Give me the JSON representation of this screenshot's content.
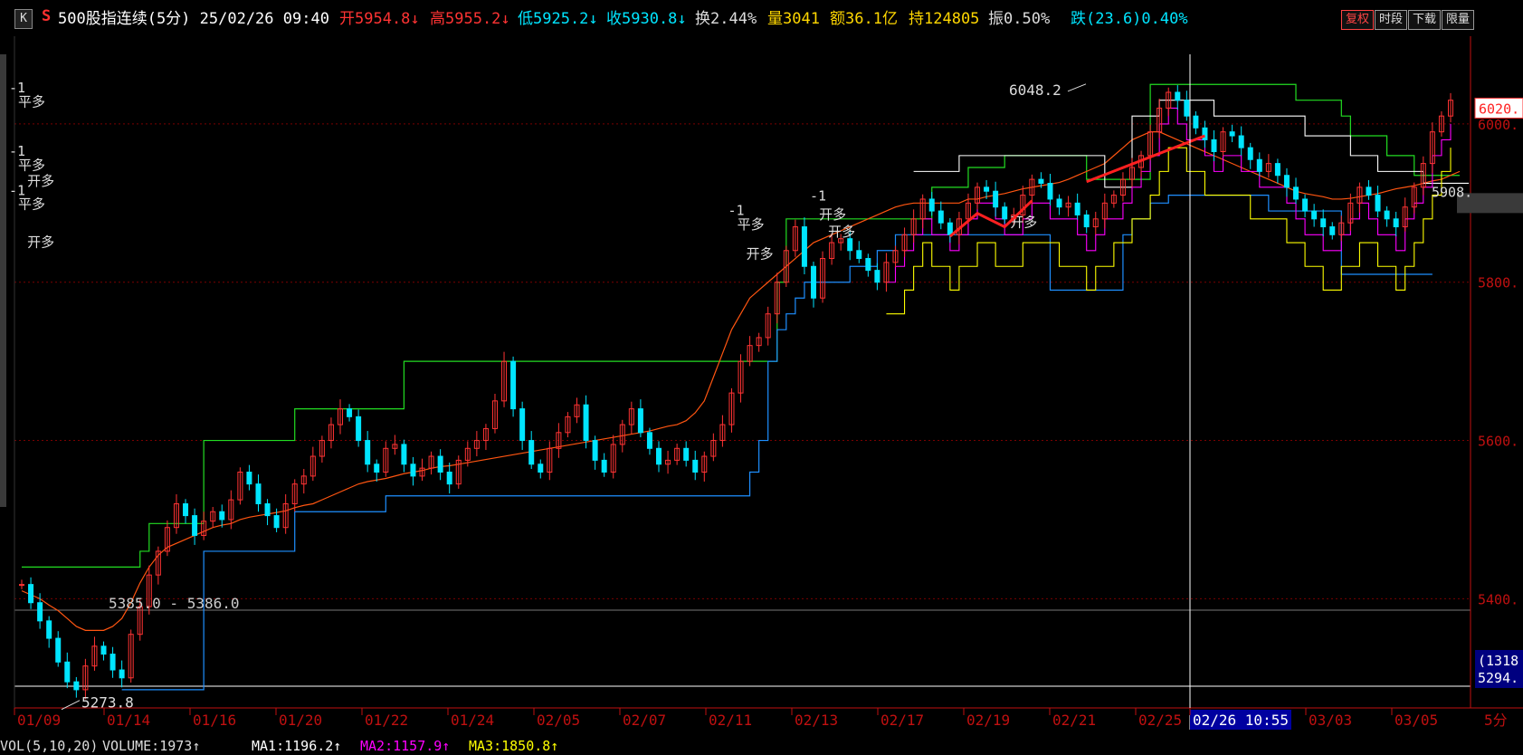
{
  "header": {
    "k_icon": "K",
    "s_icon": "S",
    "title": "500股指连续(5分) 25/02/26 09:40",
    "open": "开5954.8↓",
    "high": "高5955.2↓",
    "low": "低5925.2↓",
    "close": "收5930.8↓",
    "turnover_rate": "换2.44%",
    "volume": "量3041",
    "amount": "额36.1亿",
    "holding": "持124805",
    "amplitude": "振0.50%",
    "change": "跌(23.6)0.40%",
    "buttons": [
      "复权",
      "时段",
      "下载",
      "限量"
    ]
  },
  "colors": {
    "up": "#ff3333",
    "down": "#00e5ff",
    "volume": "#ffd700",
    "holding": "#ffd700",
    "axis": "#c01010",
    "ma1": "#ffffff",
    "ma2": "#ff00ff",
    "ma3": "#ffff00",
    "channel_top": "#22dd22",
    "channel_mid": "#ff5511",
    "channel_bottom": "#1e8fff",
    "channel_white": "#ffffff",
    "channel_magenta": "#ff00ff",
    "channel_yellow": "#ffff00"
  },
  "chart_data": {
    "type": "candlestick",
    "instrument": "500股指连续",
    "period": "5分",
    "y_ticks": [
      5400,
      5600,
      5800,
      6000
    ],
    "y_tick_labels": [
      "5400.",
      "5600.",
      "5800.",
      "6000."
    ],
    "ylim": [
      5262,
      6088
    ],
    "x_tick_labels": [
      "01/09",
      "01/14",
      "01/16",
      "01/20",
      "01/22",
      "01/24",
      "02/05",
      "02/07",
      "02/11",
      "02/13",
      "02/17",
      "02/19",
      "02/21",
      "02/25",
      "02/26 10:55",
      "03/03",
      "03/05"
    ],
    "cursor_label": "02/26 10:55",
    "period_label": "5分",
    "last_price_label": "6020.",
    "price_label_2": "5908.",
    "bottom_badge_1": "(1318",
    "bottom_badge_2": "5294.",
    "annotations": {
      "high_label": "6048.2",
      "low_label": "5273.8",
      "range_label": "5385.0 - 5386.0"
    },
    "signals": [
      {
        "text": "-1",
        "x": "02/11",
        "y": 5885
      },
      {
        "text": "平多",
        "x": "02/11",
        "y": 5867
      },
      {
        "text": "开多",
        "x": "02/11",
        "y": 5830
      },
      {
        "text": "-1",
        "x": "02/12",
        "y": 5910
      },
      {
        "text": "平多",
        "x": "02/12",
        "y": 5893
      },
      {
        "text": "开多",
        "x": "02/12",
        "y": 5845
      },
      {
        "text": "-1",
        "x": "02/13",
        "y": 5903
      },
      {
        "text": "开多",
        "x": "02/13",
        "y": 5880
      },
      {
        "text": "开多",
        "x": "02/13",
        "y": 5858
      },
      {
        "text": "-1",
        "x": "02/14",
        "y": 5960
      },
      {
        "text": "平多",
        "x": "02/14",
        "y": 5942
      },
      {
        "text": "开多",
        "x": "02/19",
        "y": 5870
      },
      {
        "text": "-1",
        "x": "02/24",
        "y": 6040
      },
      {
        "text": "平多",
        "x": "02/24",
        "y": 6022
      },
      {
        "text": "开多",
        "x": "03/06",
        "y": 5922
      }
    ],
    "close_series": [
      5418,
      5395,
      5372,
      5350,
      5320,
      5295,
      5285,
      5315,
      5340,
      5330,
      5310,
      5300,
      5355,
      5390,
      5430,
      5460,
      5490,
      5520,
      5505,
      5480,
      5498,
      5510,
      5500,
      5525,
      5560,
      5545,
      5520,
      5505,
      5490,
      5520,
      5545,
      5555,
      5580,
      5600,
      5620,
      5640,
      5630,
      5600,
      5570,
      5560,
      5590,
      5595,
      5570,
      5555,
      5565,
      5580,
      5560,
      5545,
      5575,
      5590,
      5600,
      5615,
      5650,
      5700,
      5640,
      5600,
      5570,
      5560,
      5590,
      5610,
      5630,
      5645,
      5600,
      5575,
      5560,
      5595,
      5620,
      5640,
      5610,
      5590,
      5570,
      5575,
      5590,
      5575,
      5560,
      5580,
      5600,
      5620,
      5660,
      5700,
      5720,
      5730,
      5760,
      5800,
      5840,
      5870,
      5820,
      5780,
      5830,
      5850,
      5855,
      5840,
      5830,
      5815,
      5800,
      5825,
      5840,
      5860,
      5880,
      5905,
      5890,
      5875,
      5860,
      5880,
      5900,
      5920,
      5915,
      5895,
      5880,
      5885,
      5910,
      5930,
      5925,
      5905,
      5895,
      5900,
      5885,
      5870,
      5880,
      5900,
      5910,
      5930,
      5945,
      5960,
      5990,
      6020,
      6040,
      6030,
      6010,
      5995,
      5980,
      5965,
      5990,
      5985,
      5970,
      5955,
      5940,
      5950,
      5935,
      5920,
      5905,
      5890,
      5880,
      5870,
      5860,
      5875,
      5900,
      5920,
      5910,
      5890,
      5880,
      5870,
      5895,
      5920,
      5950,
      5990,
      6010,
      6030
    ],
    "ma_lines": {
      "ma1": [
        null,
        null,
        null,
        null,
        null,
        null,
        null,
        null,
        null,
        null,
        null,
        null,
        null,
        null,
        null,
        null,
        null,
        null,
        null,
        null,
        null,
        null,
        null,
        null,
        null,
        null,
        null,
        null,
        null,
        null,
        null,
        null,
        null,
        null,
        null,
        null,
        null,
        null,
        null,
        null,
        null,
        null,
        null,
        null,
        null,
        null,
        null,
        null,
        null,
        null,
        null,
        null,
        null,
        null,
        null,
        null,
        null,
        null,
        null,
        null,
        null,
        null,
        null,
        null,
        null,
        null,
        null,
        null,
        null,
        null,
        null,
        null,
        null,
        null,
        null,
        null,
        null,
        null,
        null,
        null,
        null,
        null,
        null,
        null,
        null,
        null,
        null,
        null,
        null,
        null,
        null,
        null,
        null,
        null,
        null,
        null,
        null,
        null,
        5940,
        5940,
        5940,
        5940,
        5940,
        5960,
        5960,
        5960,
        5960,
        5960,
        5960,
        5960,
        5960,
        5960,
        5960,
        5960,
        5960,
        5960,
        5960,
        5960,
        5960,
        5920,
        5920,
        5920,
        6010,
        6010,
        6010,
        6030,
        6030,
        6030,
        6030,
        6030,
        6030,
        6010,
        6010,
        6010,
        6010,
        6010,
        6010,
        6010,
        6010,
        6010,
        6010,
        5985,
        5985,
        5985,
        5985,
        5985,
        5960,
        5960,
        5960,
        5940,
        5940,
        5940,
        5940,
        5940,
        5925,
        5925,
        5925,
        5925,
        5925,
        5925
      ]
    },
    "channels": {
      "top": [
        5440,
        5440,
        5440,
        5440,
        5440,
        5440,
        5440,
        5440,
        5440,
        5440,
        5440,
        5440,
        5440,
        5460,
        5495,
        5495,
        5495,
        5495,
        5495,
        5495,
        5600,
        5600,
        5600,
        5600,
        5600,
        5600,
        5600,
        5600,
        5600,
        5600,
        5640,
        5640,
        5640,
        5640,
        5640,
        5640,
        5640,
        5640,
        5640,
        5640,
        5640,
        5640,
        5700,
        5700,
        5700,
        5700,
        5700,
        5700,
        5700,
        5700,
        5700,
        5700,
        5700,
        5700,
        5700,
        5700,
        5700,
        5700,
        5700,
        5700,
        5700,
        5700,
        5700,
        5700,
        5700,
        5700,
        5700,
        5700,
        5700,
        5700,
        5700,
        5700,
        5700,
        5700,
        5700,
        5700,
        5700,
        5700,
        5700,
        5700,
        5700,
        5700,
        5700,
        5800,
        5880,
        5880,
        5880,
        5880,
        5880,
        5880,
        5880,
        5880,
        5880,
        5880,
        5880,
        5880,
        5880,
        5880,
        5880,
        5880,
        5920,
        5920,
        5920,
        5920,
        5945,
        5945,
        5945,
        5945,
        5960,
        5960,
        5960,
        5960,
        5960,
        5960,
        5960,
        5960,
        5960,
        5930,
        5930,
        5930,
        5930,
        5930,
        5930,
        5930,
        6050,
        6050,
        6050,
        6050,
        6050,
        6050,
        6050,
        6050,
        6050,
        6050,
        6050,
        6050,
        6050,
        6050,
        6050,
        6050,
        6030,
        6030,
        6030,
        6030,
        6030,
        6010,
        5985,
        5985,
        5985,
        5985,
        5960,
        5960,
        5960,
        5935,
        5935,
        5935,
        5935,
        5935,
        5935
      ],
      "bottom": [
        null,
        null,
        null,
        null,
        null,
        null,
        null,
        null,
        null,
        null,
        null,
        5285,
        5285,
        5285,
        5285,
        5285,
        5285,
        5285,
        5285,
        5285,
        5460,
        5460,
        5460,
        5460,
        5460,
        5460,
        5460,
        5460,
        5460,
        5460,
        5510,
        5510,
        5510,
        5510,
        5510,
        5510,
        5510,
        5510,
        5510,
        5510,
        5530,
        5530,
        5530,
        5530,
        5530,
        5530,
        5530,
        5530,
        5530,
        5530,
        5530,
        5530,
        5530,
        5530,
        5530,
        5530,
        5530,
        5530,
        5530,
        5530,
        5530,
        5530,
        5530,
        5530,
        5530,
        5530,
        5530,
        5530,
        5530,
        5530,
        5530,
        5530,
        5530,
        5530,
        5530,
        5530,
        5530,
        5530,
        5530,
        5530,
        5560,
        5600,
        5700,
        5740,
        5760,
        5780,
        5800,
        5800,
        5800,
        5800,
        5800,
        5820,
        5820,
        5820,
        5840,
        5840,
        5860,
        5860,
        5860,
        5860,
        5860,
        5860,
        5860,
        5860,
        5860,
        5860,
        5860,
        5860,
        5860,
        5860,
        5860,
        5860,
        5860,
        5790,
        5790,
        5790,
        5790,
        5790,
        5790,
        5790,
        5790,
        5860,
        5880,
        5880,
        5900,
        5900,
        5910,
        5910,
        5910,
        5910,
        5910,
        5910,
        5910,
        5910,
        5910,
        5910,
        5910,
        5890,
        5890,
        5890,
        5890,
        5890,
        5890,
        5890,
        5890,
        5810,
        5810,
        5810,
        5810,
        5810,
        5810,
        5810,
        5810,
        5810,
        5810,
        5810
      ],
      "mid": [
        5410,
        5405,
        5400,
        5392,
        5385,
        5375,
        5365,
        5360,
        5360,
        5360,
        5365,
        5375,
        5395,
        5420,
        5440,
        5455,
        5465,
        5470,
        5475,
        5480,
        5485,
        5490,
        5493,
        5495,
        5500,
        5503,
        5505,
        5507,
        5509,
        5511,
        5515,
        5518,
        5520,
        5525,
        5530,
        5535,
        5540,
        5545,
        5548,
        5550,
        5552,
        5555,
        5558,
        5560,
        5562,
        5565,
        5567,
        5568,
        5570,
        5572,
        5574,
        5576,
        5578,
        5580,
        5582,
        5584,
        5586,
        5588,
        5590,
        5592,
        5594,
        5596,
        5598,
        5600,
        5602,
        5604,
        5606,
        5608,
        5610,
        5612,
        5615,
        5618,
        5620,
        5625,
        5635,
        5650,
        5680,
        5710,
        5740,
        5760,
        5780,
        5790,
        5800,
        5810,
        5820,
        5830,
        5840,
        5850,
        5855,
        5860,
        5865,
        5870,
        5875,
        5880,
        5885,
        5890,
        5895,
        5898,
        5900,
        5900,
        5900,
        5900,
        5900,
        5900,
        5905,
        5905,
        5908,
        5910,
        5912,
        5915,
        5918,
        5920,
        5922,
        5924,
        5926,
        5930,
        5935,
        5940,
        5945,
        5950,
        5960,
        5970,
        5980,
        5985,
        5990,
        5990,
        5985,
        5980,
        5975,
        5970,
        5965,
        5960,
        5955,
        5950,
        5945,
        5940,
        5935,
        5930,
        5925,
        5920,
        5915,
        5912,
        5910,
        5908,
        5905,
        5905,
        5906,
        5908,
        5910,
        5912,
        5915,
        5918,
        5920,
        5922,
        5925,
        5928,
        5930,
        5935,
        5940
      ]
    }
  },
  "volume_panel": {
    "label": "VOL(5,10,20)",
    "volume": "VOLUME:1973↑",
    "ma1": "MA1:1196.2↑",
    "ma2": "MA2:1157.9↑",
    "ma3": "MA3:1850.8↑"
  }
}
